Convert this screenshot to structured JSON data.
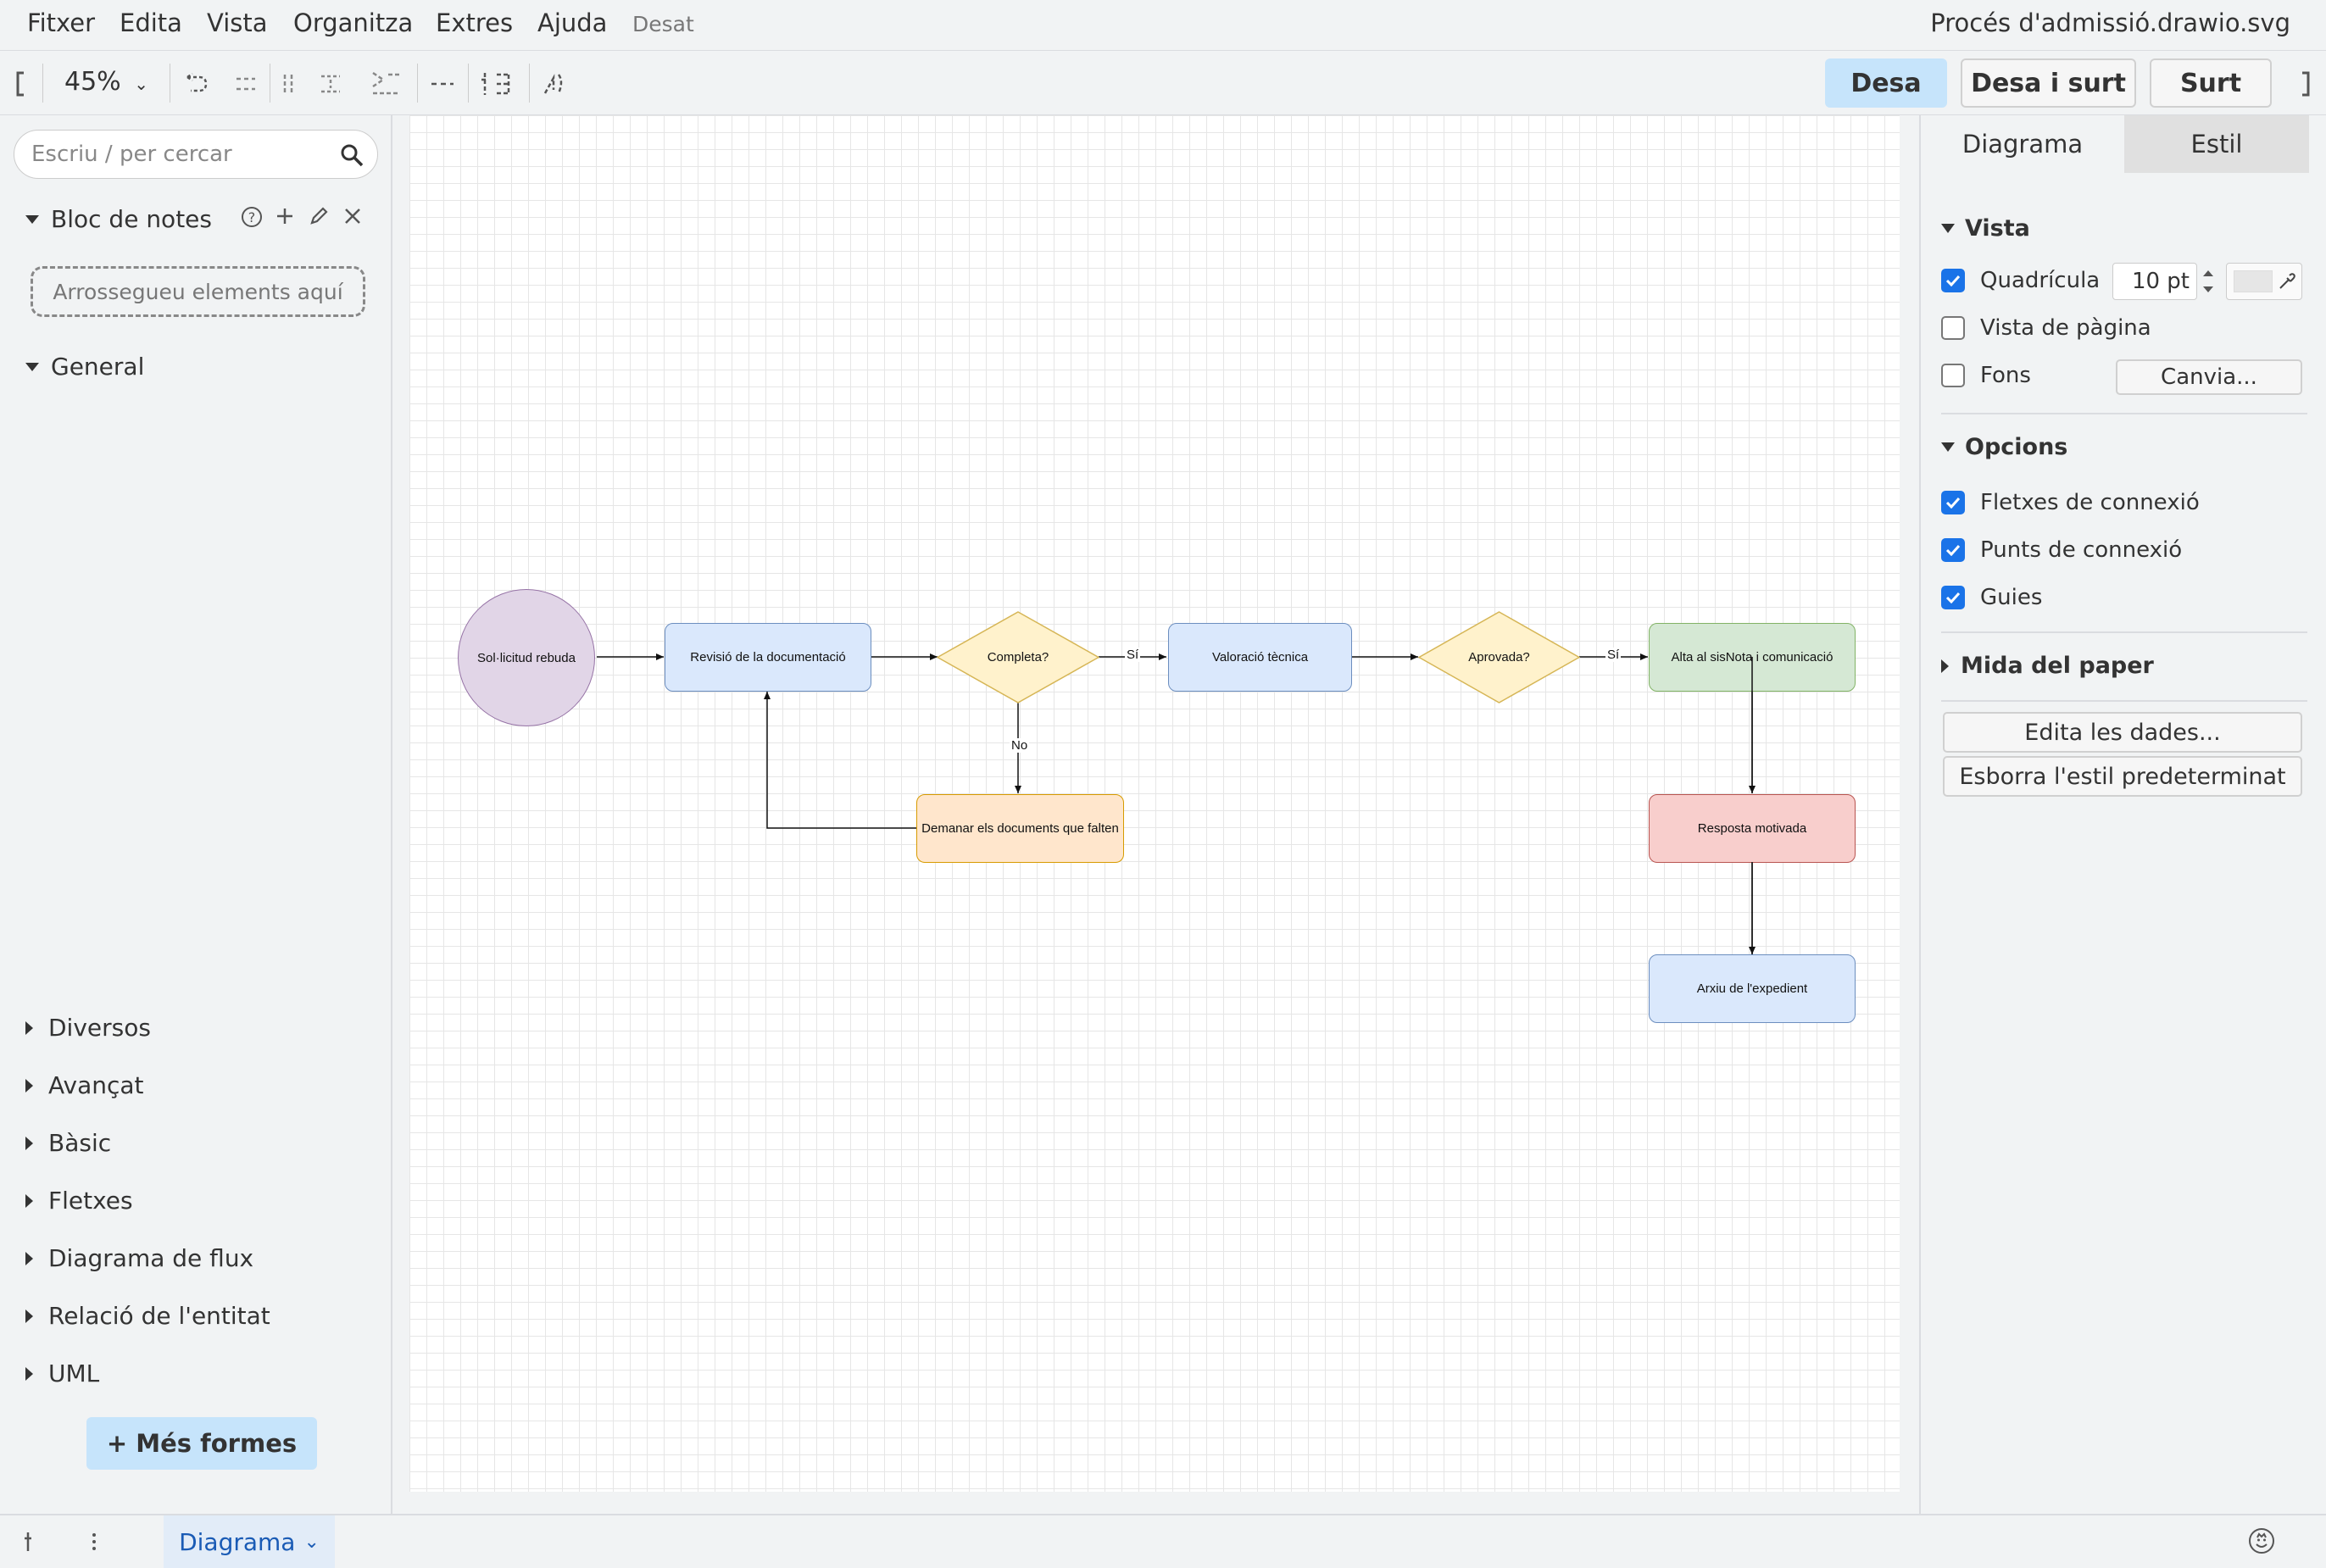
{
  "menubar": {
    "items": [
      "Fitxer",
      "Edita",
      "Vista",
      "Organitza",
      "Extres",
      "Ajuda"
    ],
    "status": "Desat",
    "title": "Procés d'admissió.drawio.svg"
  },
  "toolbar": {
    "zoom": "45%",
    "save_label": "Desa",
    "save_exit_label": "Desa i surt",
    "exit_label": "Surt"
  },
  "sidebar": {
    "search_placeholder": "Escriu / per cercar",
    "notes_title": "Bloc de notes",
    "dropzone": "Arrossegueu elements aquí",
    "general": "General",
    "libraries": [
      "Diversos",
      "Avançat",
      "Bàsic",
      "Fletxes",
      "Diagrama de flux",
      "Relació de l'entitat",
      "UML"
    ],
    "more_shapes": "+ Més formes"
  },
  "diagram": {
    "nodes": {
      "start": "Sol·licitud rebuda",
      "review": "Revisió de la documentació",
      "complete": "Completa?",
      "technical": "Valoració tècnica",
      "approved": "Aprovada?",
      "register": "Alta al sisNota i comunicació",
      "missing": "Demanar els documents que falten",
      "reasoned": "Resposta motivada",
      "archive": "Arxiu de l'expedient"
    },
    "edges": {
      "yes1": "Sí",
      "no": "No",
      "yes2": "Sí"
    },
    "colors": {
      "start_fill": "#e1d5e7",
      "start_stroke": "#9673a6",
      "blue_fill": "#dae8fc",
      "blue_stroke": "#6c8ebf",
      "yellow_fill": "#fff2cc",
      "yellow_stroke": "#d6b656",
      "orange_fill": "#ffe6cc",
      "orange_stroke": "#d79b00",
      "green_fill": "#d5e8d4",
      "green_stroke": "#82b366",
      "red_fill": "#f8cecc",
      "red_stroke": "#b85450"
    }
  },
  "rpanel": {
    "tab_diagram": "Diagrama",
    "tab_style": "Estil",
    "view_section": "Vista",
    "grid_label": "Quadrícula",
    "grid_size": "10 pt",
    "page_view_label": "Vista de pàgina",
    "background_label": "Fons",
    "change_label": "Canvia...",
    "options_section": "Opcions",
    "connection_arrows": "Fletxes de connexió",
    "connection_points": "Punts de connexió",
    "guides": "Guies",
    "paper_size_section": "Mida del paper",
    "edit_data": "Edita les dades...",
    "clear_default_style": "Esborra l'estil predeterminat"
  },
  "bottombar": {
    "page_tab": "Diagrama"
  }
}
